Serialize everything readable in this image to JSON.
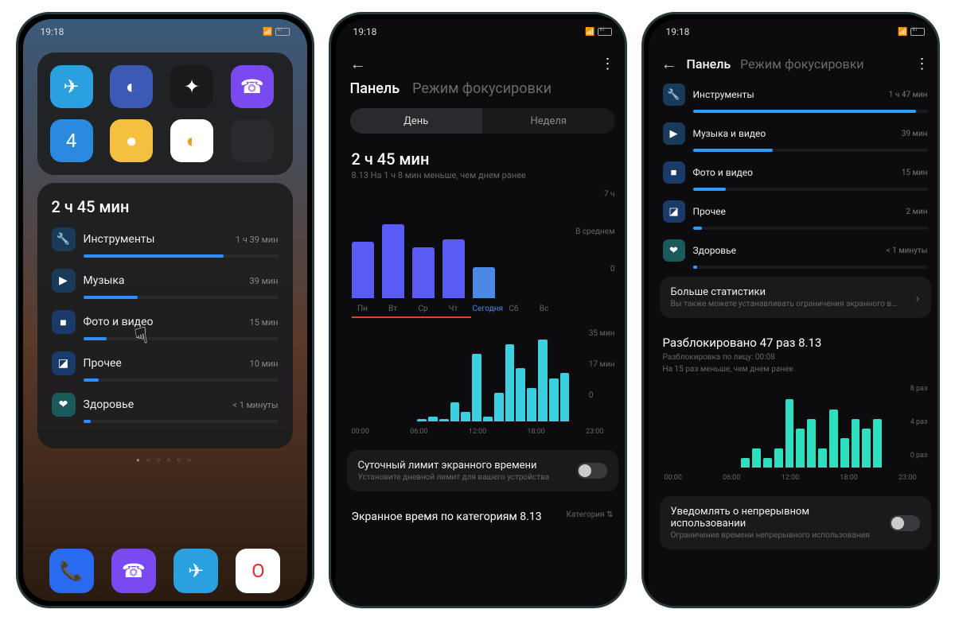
{
  "status": {
    "time": "19:18",
    "battery": "61"
  },
  "home": {
    "usage_widget": {
      "total": "2 ч 45 мин",
      "items": [
        {
          "icon": "🔧",
          "bg": "#1a3a5a",
          "label": "Инструменты",
          "time": "1 ч 39 мин",
          "fill": 72
        },
        {
          "icon": "▶",
          "bg": "#1a3a5a",
          "label": "Музыка",
          "time": "39 мин",
          "fill": 28
        },
        {
          "icon": "■",
          "bg": "#1a3a6a",
          "label": "Фото и видео",
          "time": "15 мин",
          "fill": 12
        },
        {
          "icon": "◪",
          "bg": "#1a3a6a",
          "label": "Прочее",
          "time": "10 мин",
          "fill": 8
        },
        {
          "icon": "❤",
          "bg": "#1a5a5a",
          "label": "Здоровье",
          "time": "< 1 минуты",
          "fill": 4
        }
      ]
    }
  },
  "panel": {
    "tab_panel": "Панель",
    "tab_focus": "Режим фокусировки",
    "seg_day": "День",
    "seg_week": "Неделя",
    "total": "2 ч 45 мин",
    "subtitle": "8.13  На 1 ч 8 мин меньше, чем днем ранее",
    "limit_label": "Суточный лимит экранного времени",
    "limit_sub": "Установите дневной лимит для вашего устройства",
    "section_title": "Экранное время по категориям 8.13",
    "section_right": "Категория"
  },
  "chart_data": [
    {
      "type": "bar",
      "note": "weekly screen time",
      "categories": [
        "Пн",
        "Вт",
        "Ср",
        "Чт",
        "Сегодня",
        "Сб",
        "Вс"
      ],
      "values": [
        5.0,
        6.5,
        4.5,
        5.2,
        2.75,
        0,
        0
      ],
      "unit": "ч",
      "ylim": [
        0,
        7
      ],
      "ylabels": [
        "7 ч",
        "В среднем",
        "0"
      ],
      "today_index": 4
    },
    {
      "type": "bar",
      "note": "today hourly usage in minutes, 24 bars 00:00–23:00",
      "x": [
        0,
        1,
        2,
        3,
        4,
        5,
        6,
        7,
        8,
        9,
        10,
        11,
        12,
        13,
        14,
        15,
        16,
        17,
        18,
        19,
        20,
        21,
        22,
        23
      ],
      "values": [
        0,
        0,
        0,
        0,
        0,
        0,
        1,
        2,
        1,
        8,
        4,
        28,
        2,
        12,
        32,
        22,
        14,
        34,
        18,
        20,
        0,
        0,
        0,
        0
      ],
      "unit": "мин",
      "ylim": [
        0,
        35
      ],
      "ylabels": [
        "35 мин",
        "17 мин",
        "0"
      ],
      "xticks": [
        "00:00",
        "06:00",
        "12:00",
        "18:00",
        "23:00"
      ]
    },
    {
      "type": "bar",
      "note": "unlocks per hour, 24 bars",
      "x": [
        0,
        1,
        2,
        3,
        4,
        5,
        6,
        7,
        8,
        9,
        10,
        11,
        12,
        13,
        14,
        15,
        16,
        17,
        18,
        19,
        20,
        21,
        22,
        23
      ],
      "values": [
        0,
        0,
        0,
        0,
        0,
        0,
        0,
        1,
        2,
        1,
        2,
        7,
        4,
        5,
        2,
        6,
        3,
        5,
        4,
        5,
        0,
        0,
        0,
        0
      ],
      "unit": "раз",
      "ylim": [
        0,
        8
      ],
      "ylabels": [
        "8 раз",
        "4 раз",
        "0 раз"
      ],
      "xticks": [
        "00:00",
        "06:00",
        "12:00",
        "18:00",
        "23:00"
      ]
    }
  ],
  "categories": {
    "items": [
      {
        "icon": "🔧",
        "bg": "#1a3a5a",
        "label": "Инструменты",
        "time": "1 ч 47 мин",
        "fill": 95
      },
      {
        "icon": "▶",
        "bg": "#1a3a5a",
        "label": "Музыка и видео",
        "time": "39 мин",
        "fill": 34
      },
      {
        "icon": "■",
        "bg": "#1a3a6a",
        "label": "Фото и видео",
        "time": "15 мин",
        "fill": 14
      },
      {
        "icon": "◪",
        "bg": "#1a3a6a",
        "label": "Прочее",
        "time": "2 мин",
        "fill": 4
      },
      {
        "icon": "❤",
        "bg": "#1a5a5a",
        "label": "Здоровье",
        "time": "< 1 минуты",
        "fill": 2
      }
    ],
    "more_title": "Больше статистики",
    "more_sub": "Вы также можете устанавливать ограничения экранного в…",
    "unlock_title": "Разблокировано 47 раз 8.13",
    "unlock_sub1": "Разблокировка по лицу: 00:08",
    "unlock_sub2": "На 15 раз меньше, чем днем ранее",
    "notify_title": "Уведомлять о непрерывном использовании",
    "notify_sub": "Ограничение времени непрерывного использования"
  }
}
